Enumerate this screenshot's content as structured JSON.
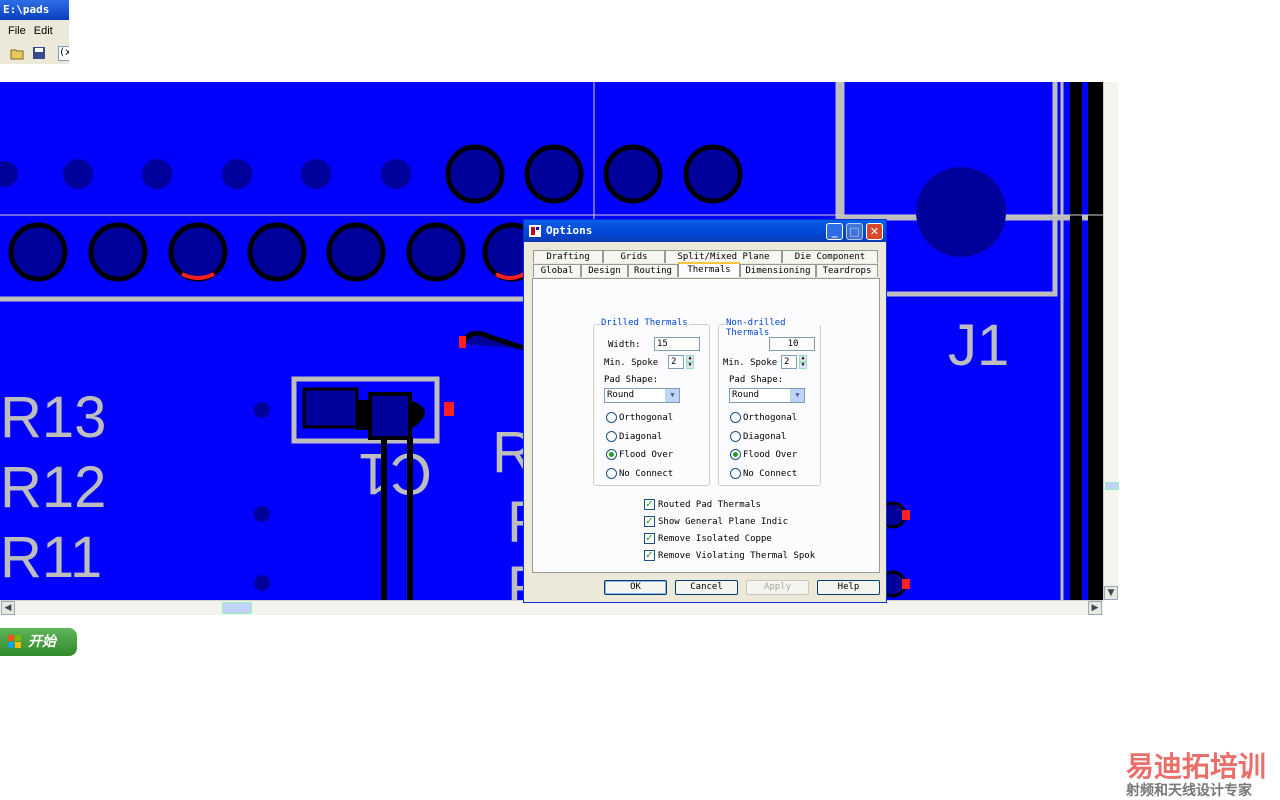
{
  "app": {
    "title": "E:\\pads",
    "menu": [
      "File",
      "Edit"
    ],
    "toolbar_icons": [
      "open-icon",
      "save-icon"
    ],
    "toolbar_combo": "(x"
  },
  "pcb": {
    "background_color": "#0000ff",
    "trace_color": "#bdbdbd",
    "labels": [
      "R13",
      "R12",
      "R11",
      "R",
      "F",
      "F",
      "C1",
      "J1"
    ]
  },
  "taskbar": {
    "start_label": "开始"
  },
  "dialog": {
    "title": "Options",
    "tabs_back": [
      "Drafting",
      "Grids",
      "Split/Mixed Plane",
      "Die Component"
    ],
    "tabs_front": [
      "Global",
      "Design",
      "Routing",
      "Thermals",
      "Dimensioning",
      "Teardrops"
    ],
    "active_tab": "Thermals",
    "drilled": {
      "title": "Drilled Thermals",
      "width_label": "Width:",
      "width": "15",
      "min_spoke_label": "Min. Spoke",
      "min_spoke": "2",
      "pad_shape_label": "Pad Shape:",
      "pad_shape": "Round",
      "options": [
        "Orthogonal",
        "Diagonal",
        "Flood Over",
        "No Connect"
      ],
      "selected": "Flood Over"
    },
    "nondrilled": {
      "title": "Non-drilled Thermals",
      "width": "10",
      "min_spoke_label": "Min. Spoke",
      "min_spoke": "2",
      "pad_shape_label": "Pad Shape:",
      "pad_shape": "Round",
      "options": [
        "Orthogonal",
        "Diagonal",
        "Flood Over",
        "No Connect"
      ],
      "selected": "Flood Over"
    },
    "checks": [
      "Routed Pad Thermals",
      "Show General Plane Indic",
      "Remove Isolated Coppe",
      "Remove Violating Thermal Spok"
    ],
    "buttons": {
      "ok": "OK",
      "cancel": "Cancel",
      "apply": "Apply",
      "help": "Help"
    }
  },
  "watermark": {
    "line1": "易迪拓培训",
    "line2": "射频和天线设计专家"
  }
}
